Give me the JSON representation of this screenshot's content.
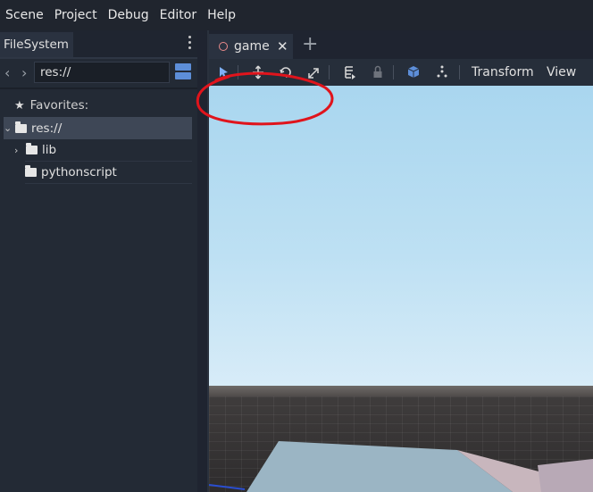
{
  "menu": [
    "Scene",
    "Project",
    "Debug",
    "Editor",
    "Help"
  ],
  "filesystem": {
    "tab_label": "FileSystem",
    "path_value": "res://",
    "favorites_label": "Favorites:",
    "tree": [
      {
        "label": "res://",
        "selected": true
      },
      {
        "label": "lib"
      },
      {
        "label": "pythonscript"
      }
    ]
  },
  "scene_tab": {
    "label": "game",
    "close": "✕",
    "add": "+"
  },
  "toolbar": {
    "icons": [
      "select-icon",
      "move-icon",
      "rotate-icon",
      "scale-icon",
      "list-icon",
      "lock-icon",
      "local-space-icon",
      "snap-icon"
    ],
    "transform_label": "Transform",
    "view_label": "View"
  },
  "annotation": {
    "color": "#e0141c"
  },
  "colors": {
    "sky_top": "#a9d6ef",
    "sky_bottom": "#d8ecf8",
    "accent": "#5d8ed8",
    "scene_dot": "#e98a8a"
  }
}
